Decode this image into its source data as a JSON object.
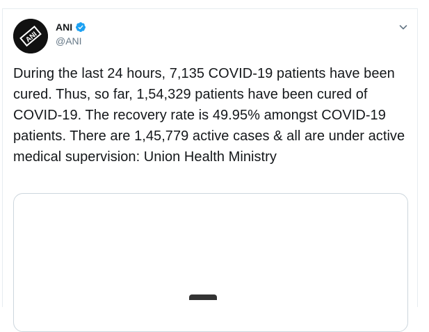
{
  "tweet": {
    "author": {
      "display_name": "ANI",
      "handle": "@ANI",
      "verified": true,
      "avatar_icon": "ani-logo-icon"
    },
    "text": "During the last 24 hours, 7,135 COVID-19 patients have been cured. Thus, so far, 1,54,329 patients have been cured of COVID-19. The recovery rate is 49.95% amongst COVID-19 patients. There are 1,45,779 active cases & all are under active medical supervision: Union Health Ministry",
    "menu_icon": "chevron-down-icon"
  },
  "colors": {
    "text_primary": "#14171a",
    "text_secondary": "#657786",
    "verified_blue": "#1da1f2",
    "border": "#e6ecf0",
    "media_border": "#ccd6dd"
  }
}
